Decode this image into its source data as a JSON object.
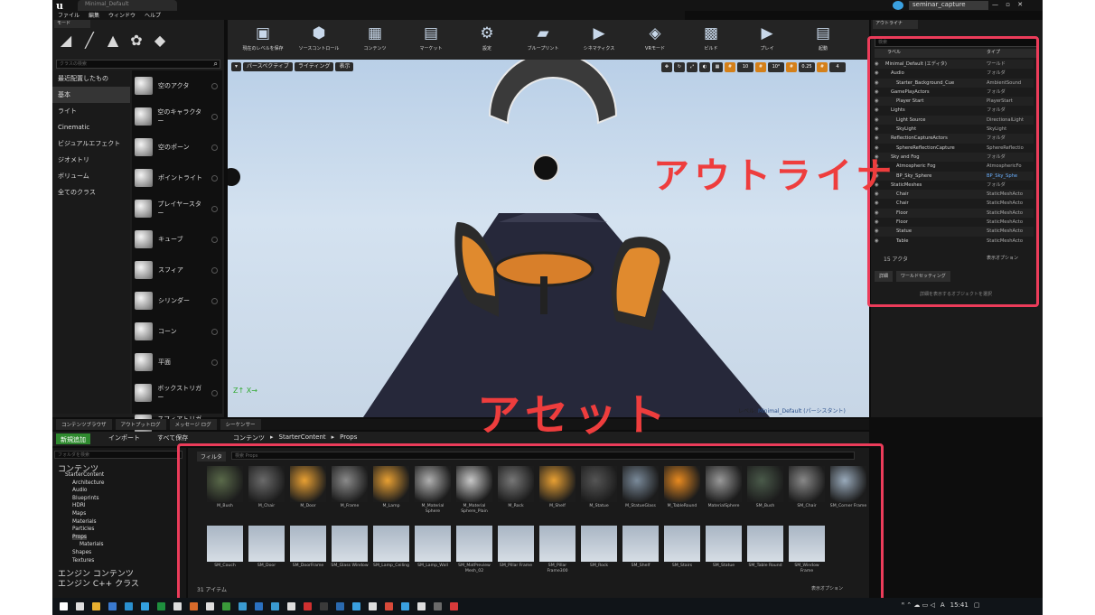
{
  "window": {
    "tab": "Minimal_Default",
    "project": "seminar_capture",
    "controls": "— ▫ ✕"
  },
  "menu": [
    "ファイル",
    "編集",
    "ウィンドウ",
    "ヘルプ"
  ],
  "modes": {
    "tab": "モード",
    "search_placeholder": "クラスの検索",
    "categories": [
      "最近配置したもの",
      "基本",
      "ライト",
      "Cinematic",
      "ビジュアルエフェクト",
      "ジオメトリ",
      "ボリューム",
      "全てのクラス"
    ],
    "selected": "基本",
    "items": [
      "空のアクタ",
      "空のキャラクター",
      "空のポーン",
      "ポイントライト",
      "プレイヤースター",
      "キューブ",
      "スフィア",
      "シリンダー",
      "コーン",
      "平面",
      "ボックストリガー",
      "スフィアトリガー"
    ]
  },
  "toolbar": [
    "現在のレベルを保存",
    "ソースコントロール",
    "コンテンツ",
    "マーケット",
    "設定",
    "ブループリント",
    "シネマティクス",
    "VRモード",
    "ビルド",
    "プレイ",
    "起動"
  ],
  "viewport": {
    "buttons": [
      "パースペクティブ",
      "ライティング",
      "表示"
    ],
    "right": [
      "10",
      "10°",
      "0.25",
      "4"
    ],
    "level_label": "レベル:",
    "level_value": "Minimal_Default (パーシスタント)"
  },
  "outliner": {
    "tab": "アウトライナ",
    "search_placeholder": "検索",
    "col_label": "ラベル",
    "col_type": "タイプ",
    "rows": [
      {
        "label": "Minimal_Default (エディタ)",
        "type": "ワールド",
        "indent": 0
      },
      {
        "label": "Audio",
        "type": "フォルダ",
        "indent": 1
      },
      {
        "label": "Starter_Background_Cue",
        "type": "AmbientSound",
        "indent": 2
      },
      {
        "label": "GamePlayActors",
        "type": "フォルダ",
        "indent": 1
      },
      {
        "label": "Player Start",
        "type": "PlayerStart",
        "indent": 2
      },
      {
        "label": "Lights",
        "type": "フォルダ",
        "indent": 1
      },
      {
        "label": "Light Source",
        "type": "DirectionalLight",
        "indent": 2
      },
      {
        "label": "SkyLight",
        "type": "SkyLight",
        "indent": 2
      },
      {
        "label": "ReflectionCaptureActors",
        "type": "フォルダ",
        "indent": 1
      },
      {
        "label": "SphereReflectionCapture",
        "type": "SphereReflectio",
        "indent": 2
      },
      {
        "label": "Sky and Fog",
        "type": "フォルダ",
        "indent": 1
      },
      {
        "label": "Atmospheric Fog",
        "type": "AtmosphericFo",
        "indent": 2
      },
      {
        "label": "BP_Sky_Sphere",
        "type": "BP_Sky_Sphe",
        "indent": 2,
        "hl": true
      },
      {
        "label": "StaticMeshes",
        "type": "フォルダ",
        "indent": 1
      },
      {
        "label": "Chair",
        "type": "StaticMeshActo",
        "indent": 2
      },
      {
        "label": "Chair",
        "type": "StaticMeshActo",
        "indent": 2
      },
      {
        "label": "Floor",
        "type": "StaticMeshActo",
        "indent": 2
      },
      {
        "label": "Floor",
        "type": "StaticMeshActo",
        "indent": 2
      },
      {
        "label": "Statue",
        "type": "StaticMeshActo",
        "indent": 2
      },
      {
        "label": "Table",
        "type": "StaticMeshActo",
        "indent": 2
      }
    ],
    "count": "15 アクタ",
    "view_options": "表示オプション",
    "details_tabs": [
      "詳細",
      "ワールドセッティング"
    ],
    "details_empty": "詳細を表示するオブジェクトを選択"
  },
  "annotations": {
    "outliner": "アウトライナ",
    "asset": "アセット",
    "color": "#ec3c5a"
  },
  "bottom_tabs": [
    "コンテンツブラウザ",
    "アウトプットログ",
    "メッセージ ログ",
    "シーケンサー"
  ],
  "content_browser": {
    "new": "新規追加",
    "import": "インポート",
    "save_all": "すべて保存",
    "breadcrumb": [
      "コンテンツ",
      "StarterContent",
      "Props"
    ],
    "folder_search": "フォルダを検索",
    "folders": [
      {
        "name": "コンテンツ",
        "big": true,
        "d": 0
      },
      {
        "name": "StarterContent",
        "d": 1
      },
      {
        "name": "Architecture",
        "d": 2
      },
      {
        "name": "Audio",
        "d": 2
      },
      {
        "name": "Blueprints",
        "d": 2
      },
      {
        "name": "HDRI",
        "d": 2
      },
      {
        "name": "Maps",
        "d": 2
      },
      {
        "name": "Materials",
        "d": 2
      },
      {
        "name": "Particles",
        "d": 2
      },
      {
        "name": "Props",
        "d": 2
      },
      {
        "name": "Materials",
        "d": 3
      },
      {
        "name": "Shapes",
        "d": 2
      },
      {
        "name": "Textures",
        "d": 2
      },
      {
        "name": "エンジン コンテンツ",
        "big": true,
        "d": 0
      },
      {
        "name": "エンジン C++ クラス",
        "big": true,
        "d": 0
      }
    ],
    "filter": "フィルタ",
    "search_placeholder": "検索 Props",
    "assets": [
      "M_Bush",
      "M_Chair",
      "M_Door",
      "M_Frame",
      "M_Lamp",
      "M_Material Sphere",
      "M_Material Sphere_Plain",
      "M_Rock",
      "M_Shelf",
      "M_Statue",
      "M_StatueGlass",
      "M_TableRound",
      "MaterialSphere",
      "SM_Bush",
      "SM_Chair",
      "SM_Corner Frame",
      "SM_Couch",
      "SM_Door",
      "SM_DoorFrame",
      "SM_Glass Window",
      "SM_Lamp_Ceiling",
      "SM_Lamp_Wall",
      "SM_MatPreview Mesh_02",
      "SM_Pillar Frame",
      "SM_Pillar Frame300",
      "SM_Rock",
      "SM_Shelf",
      "SM_Stairs",
      "SM_Statue",
      "SM_Table Round",
      "SM_Window Frame"
    ],
    "count": "31 アイテム",
    "view_options": "表示オプション"
  },
  "taskbar": {
    "time": "15:41",
    "ime": "A"
  }
}
